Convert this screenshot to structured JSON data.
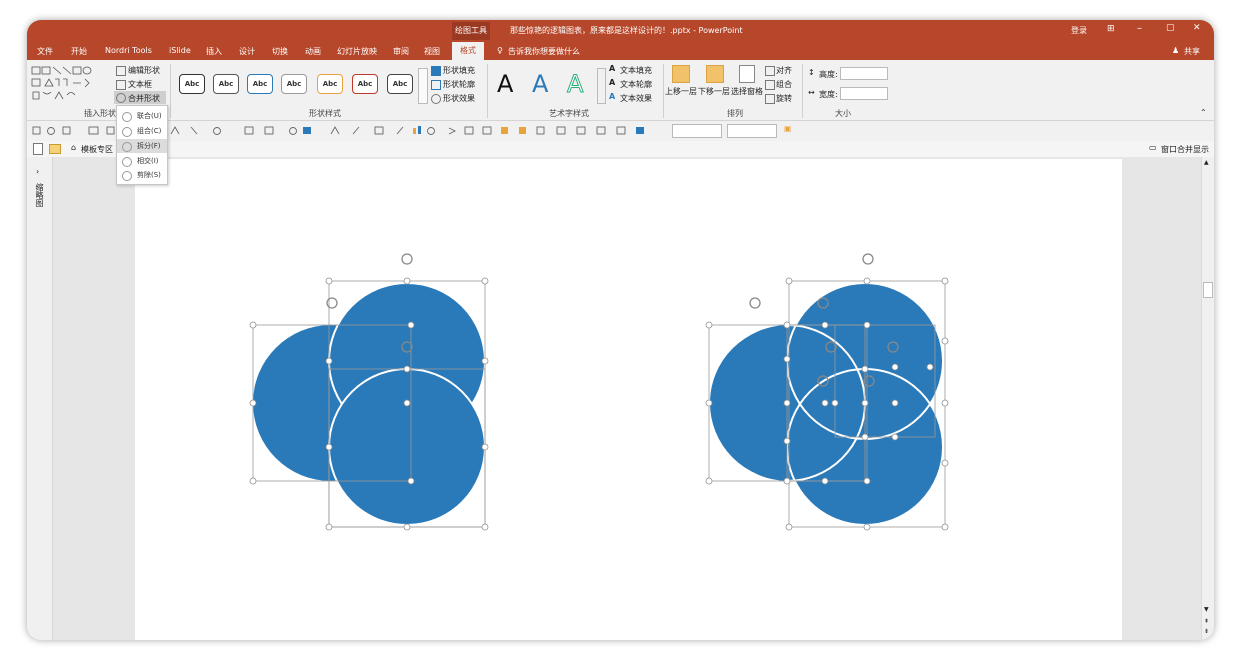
{
  "titlebar": {
    "context_tool": "绘图工具",
    "doc_title": "那些惊艳的逻辑图表，原来都是这样设计的！.pptx - PowerPoint",
    "login": "登录",
    "minimize": "–",
    "restore": "▢",
    "close": "✕"
  },
  "tabs": [
    "文件",
    "开始",
    "Nordri Tools",
    "iSlide",
    "插入",
    "设计",
    "切换",
    "动画",
    "幻灯片放映",
    "审阅",
    "视图",
    "格式"
  ],
  "tell_me": "告诉我你想要做什么",
  "share": "共享",
  "ribbon": {
    "insert_shapes": {
      "label": "插入形状",
      "edit_shape": "编辑形状",
      "text_box": "文本框",
      "merge_shapes": "合并形状"
    },
    "shape_styles": {
      "label": "形状样式",
      "swatch_text": "Abc",
      "fill": "形状填充",
      "outline": "形状轮廓",
      "effects": "形状效果"
    },
    "wordart": {
      "label": "艺术字样式",
      "letter": "A",
      "text_fill": "文本填充",
      "text_outline": "文本轮廓",
      "text_effects": "文本效果"
    },
    "arrange": {
      "label": "排列",
      "bring_forward": "上移一层",
      "send_backward": "下移一层",
      "selection_pane": "选择窗格",
      "align": "对齐",
      "group": "组合",
      "rotate": "旋转"
    },
    "size": {
      "label": "大小",
      "height": "高度:",
      "width": "宽度:"
    }
  },
  "merge_menu": {
    "items": [
      "联合(U)",
      "组合(C)",
      "拆分(F)",
      "相交(I)",
      "剪除(S)"
    ],
    "highlighted_index": 2
  },
  "row3": {
    "template_zone": "模板专区",
    "window_merge": "窗口合并显示"
  },
  "left_panel": {
    "label": "缩略图"
  },
  "colors": {
    "title_bar": "#b7472a",
    "circle_fill": "#2a7ab9",
    "handle": "#9a9a9a"
  }
}
